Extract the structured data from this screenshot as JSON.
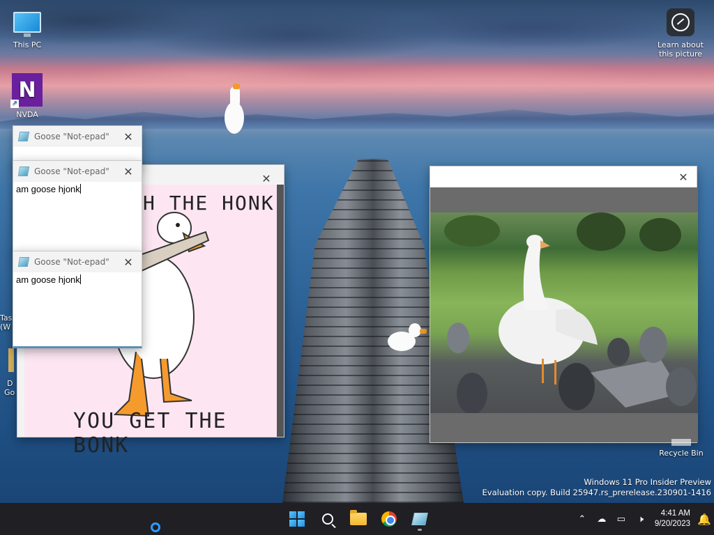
{
  "desktop": {
    "icons": [
      {
        "label": "This PC",
        "icon": "this-pc-icon"
      },
      {
        "label": "NVDA",
        "icon": "nvda-icon"
      },
      {
        "label": "Learn about this picture",
        "icon": "learn-about-picture-icon"
      }
    ],
    "partial_labels": {
      "tas": "Tas",
      "w": "(W",
      "d": "D",
      "go": "Go"
    },
    "recycle_bin": "Recycle Bin",
    "watermark": {
      "line1": "Windows 11 Pro Insider Preview",
      "line2": "Evaluation copy. Build 25947.rs_prerelease.230901-1416"
    }
  },
  "notepad_windows": [
    {
      "title": "Goose \"Not-epad\"",
      "text": ""
    },
    {
      "title": "Goose \"Not-epad\"",
      "text": "am goose hjonk"
    },
    {
      "title": "Goose \"Not-epad\"",
      "text": "am goose hjonk"
    }
  ],
  "meme_window": {
    "top_text": "H THE HONK",
    "bottom_text": "YOU GET THE BONK"
  },
  "close_glyph": "✕",
  "taskbar": {
    "apps": [
      {
        "name": "start",
        "icon": "windows-start-icon"
      },
      {
        "name": "search",
        "icon": "search-icon"
      },
      {
        "name": "file-explorer",
        "icon": "file-explorer-icon"
      },
      {
        "name": "chrome",
        "icon": "chrome-icon"
      },
      {
        "name": "notepad",
        "icon": "notepad-icon"
      }
    ],
    "tray": {
      "time": "4:41 AM",
      "date": "9/20/2023"
    }
  },
  "colors": {
    "taskbar": "#1f1f24",
    "accent": "#2f9bff",
    "goose_beak": "#f29a2a"
  }
}
